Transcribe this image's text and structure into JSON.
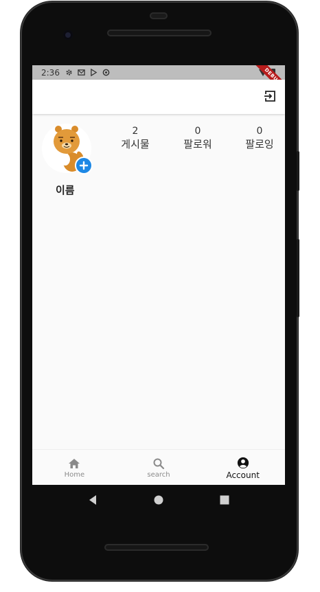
{
  "status_bar": {
    "time": "2:36",
    "debug_label": "DEBUG"
  },
  "profile": {
    "name": "이름",
    "stats": [
      {
        "value": "2",
        "label": "게시물"
      },
      {
        "value": "0",
        "label": "팔로워"
      },
      {
        "value": "0",
        "label": "팔로잉"
      }
    ]
  },
  "bottom_nav": {
    "items": [
      {
        "label": "Home",
        "icon": "home-icon"
      },
      {
        "label": "search",
        "icon": "search-icon"
      },
      {
        "label": "Account",
        "icon": "account-circle-icon"
      }
    ],
    "active_index": 2
  },
  "colors": {
    "accent": "#1e88e5",
    "status_bar": "#bdbdbd",
    "debug_ribbon": "#b71c1c",
    "avatar_fur": "#d98c2b"
  }
}
